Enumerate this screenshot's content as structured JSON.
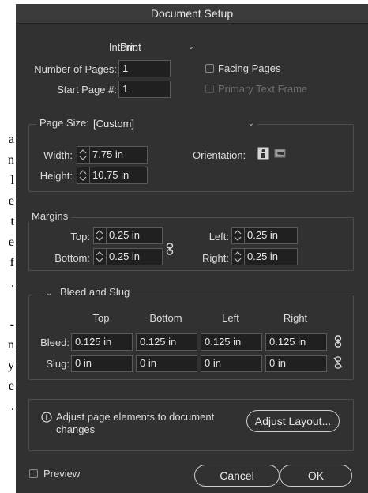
{
  "background_text": [
    "a",
    "n",
    "l",
    "e",
    "t",
    "e",
    "f",
    ".",
    "-",
    "n",
    "y",
    "e",
    "."
  ],
  "dialog": {
    "title": "Document Setup",
    "intent_label": "Intent:",
    "intent_value": "Print",
    "num_pages_label": "Number of Pages:",
    "num_pages_value": "1",
    "start_page_label": "Start Page #:",
    "start_page_value": "1",
    "facing_pages_label": "Facing Pages",
    "primary_text_frame_label": "Primary Text Frame",
    "page_size_label": "Page Size:",
    "page_size_value": "[Custom]",
    "width_label": "Width:",
    "width_value": "7.75 in",
    "height_label": "Height:",
    "height_value": "10.75 in",
    "orientation_label": "Orientation:",
    "margins": {
      "title": "Margins",
      "top_label": "Top:",
      "top_value": "0.25 in",
      "bottom_label": "Bottom:",
      "bottom_value": "0.25 in",
      "left_label": "Left:",
      "left_value": "0.25 in",
      "right_label": "Right:",
      "right_value": "0.25 in"
    },
    "bleed_slug": {
      "title": "Bleed and Slug",
      "columns": [
        "Top",
        "Bottom",
        "Left",
        "Right"
      ],
      "bleed_label": "Bleed:",
      "bleed_values": [
        "0.125 in",
        "0.125 in",
        "0.125 in",
        "0.125 in"
      ],
      "slug_label": "Slug:",
      "slug_values": [
        "0 in",
        "0 in",
        "0 in",
        "0 in"
      ]
    },
    "info_text_line1": "Adjust page elements to document",
    "info_text_line2": "changes",
    "adjust_layout_label": "Adjust Layout...",
    "preview_label": "Preview",
    "cancel_label": "Cancel",
    "ok_label": "OK"
  }
}
